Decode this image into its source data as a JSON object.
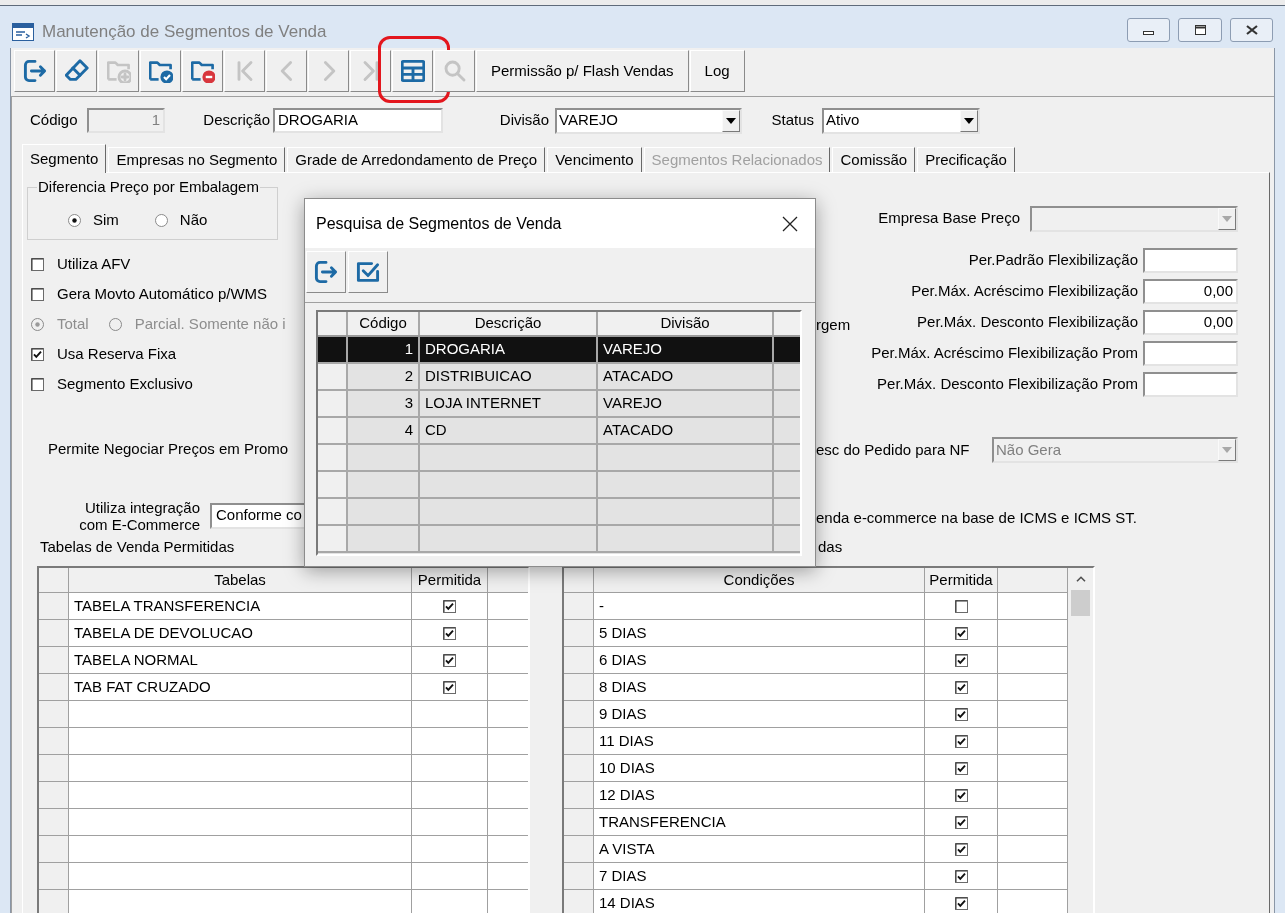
{
  "window": {
    "title": "Manutenção de Segmentos de Venda"
  },
  "toolbar": [
    {
      "kind": "exit",
      "disabled": false,
      "highlighted": false
    },
    {
      "kind": "clear",
      "disabled": false,
      "highlighted": false
    },
    {
      "kind": "new",
      "disabled": true,
      "highlighted": false
    },
    {
      "kind": "save",
      "disabled": false,
      "highlighted": false
    },
    {
      "kind": "delete",
      "disabled": false,
      "highlighted": false
    },
    {
      "kind": "first",
      "disabled": true,
      "highlighted": false
    },
    {
      "kind": "previous",
      "disabled": true,
      "highlighted": false
    },
    {
      "kind": "next",
      "disabled": true,
      "highlighted": false
    },
    {
      "kind": "last",
      "disabled": true,
      "highlighted": false
    },
    {
      "kind": "grid",
      "disabled": false,
      "highlighted": true
    },
    {
      "kind": "search",
      "disabled": true,
      "highlighted": false
    },
    {
      "kind": "text",
      "label": "Permissão p/ Flash Vendas",
      "disabled": false,
      "highlighted": false
    },
    {
      "kind": "text",
      "label": "Log",
      "disabled": false,
      "highlighted": false
    }
  ],
  "header_fields": [
    {
      "kind": "number",
      "label": "Código",
      "value": "1",
      "disabled": true
    },
    {
      "kind": "text",
      "label": "Descrição",
      "value": "DROGARIA",
      "disabled": false
    },
    {
      "kind": "select",
      "label": "Divisão",
      "value": "VAREJO",
      "disabled": false
    },
    {
      "kind": "select",
      "label": "Status",
      "value": "Ativo",
      "disabled": false
    }
  ],
  "tabs": [
    {
      "label": "Segmento",
      "selected": true,
      "disabled": false
    },
    {
      "label": "Empresas no Segmento",
      "selected": false,
      "disabled": false
    },
    {
      "label": "Grade de Arredondamento de Preço",
      "selected": false,
      "disabled": false
    },
    {
      "label": "Vencimento",
      "selected": false,
      "disabled": false
    },
    {
      "label": "Segmentos Relacionados",
      "selected": false,
      "disabled": true
    },
    {
      "label": "Comissão",
      "selected": false,
      "disabled": false
    },
    {
      "label": "Precificação",
      "selected": false,
      "disabled": false
    }
  ],
  "segment_tab": {
    "package_pricing": {
      "title": "Diferencia Preço por Embalagem",
      "options": [
        {
          "label": "Sim",
          "selected": true
        },
        {
          "label": "Não",
          "selected": false
        }
      ]
    },
    "left_options": [
      {
        "kind": "checkbox",
        "label": "Utiliza AFV",
        "checked": false
      },
      {
        "kind": "checkbox",
        "label": "Gera Movto Automático p/WMS",
        "checked": false
      },
      {
        "kind": "radio_group",
        "disabled": true,
        "options": [
          {
            "label": "Total",
            "selected": true
          },
          {
            "label": "Parcial. Somente não i",
            "selected": false
          }
        ]
      },
      {
        "kind": "checkbox",
        "label": "Usa Reserva Fixa",
        "checked": true
      },
      {
        "kind": "checkbox",
        "label": "Segmento Exclusivo",
        "checked": false
      }
    ],
    "promo_label": "Permite Negociar Preços em Promo",
    "ecommerce": {
      "label": "Utiliza integração com E-Commerce",
      "value": "Conforme co"
    },
    "company_base": {
      "label": "Empresa Base Preço",
      "disabled": true
    },
    "flex_fields": [
      {
        "label": "Per.Padrão Flexibilização"
      },
      {
        "label": "Per.Máx. Acréscimo Flexibilização",
        "value": "0,00"
      },
      {
        "label": "Per.Máx. Desconto Flexibilização",
        "value": "0,00"
      },
      {
        "label": "Per.Máx. Acréscimo Flexibilização Prom"
      },
      {
        "label": "Per.Máx. Desconto Flexibilização Prom"
      }
    ],
    "cut_text_1": "rgem",
    "nf_select": {
      "label": "esc do Pedido para NF",
      "value": "Não Gera",
      "disabled": true
    },
    "cut_text_2": "enda e-commerce na base de ICMS e ICMS ST.",
    "sales_tables": {
      "title": "Tabelas de Venda Permitidas",
      "columns": [
        "Tabelas",
        "Permitida"
      ],
      "rows": [
        {
          "name": "TABELA TRANSFERENCIA",
          "checked": true
        },
        {
          "name": "TABELA DE DEVOLUCAO",
          "checked": true
        },
        {
          "name": "TABELA NORMAL",
          "checked": true
        },
        {
          "name": "TAB FAT CRUZADO",
          "checked": true
        }
      ]
    },
    "conditions": {
      "title": "das",
      "columns": [
        "Condições",
        "Permitida"
      ],
      "rows": [
        {
          "name": "-",
          "checked": false
        },
        {
          "name": "5 DIAS",
          "checked": true
        },
        {
          "name": "6 DIAS",
          "checked": true
        },
        {
          "name": "8 DIAS",
          "checked": true
        },
        {
          "name": "9 DIAS",
          "checked": true
        },
        {
          "name": "11 DIAS",
          "checked": true
        },
        {
          "name": "10 DIAS",
          "checked": true
        },
        {
          "name": "12 DIAS",
          "checked": true
        },
        {
          "name": "TRANSFERENCIA",
          "checked": true
        },
        {
          "name": "A VISTA",
          "checked": true
        },
        {
          "name": "7 DIAS",
          "checked": true
        },
        {
          "name": "14 DIAS",
          "checked": true
        }
      ]
    }
  },
  "search_dialog": {
    "title": "Pesquisa de Segmentos de Venda",
    "toolbar": [
      {
        "kind": "exit"
      },
      {
        "kind": "confirm"
      }
    ],
    "columns": [
      "Código",
      "Descrição",
      "Divisão"
    ],
    "rows": [
      {
        "cells": [
          "1",
          "DROGARIA",
          "VAREJO"
        ],
        "selected": true
      },
      {
        "cells": [
          "2",
          "DISTRIBUICAO",
          "ATACADO"
        ],
        "selected": false
      },
      {
        "cells": [
          "3",
          "LOJA INTERNET",
          "VAREJO"
        ],
        "selected": false
      },
      {
        "cells": [
          "4",
          "CD",
          "ATACADO"
        ],
        "selected": false
      }
    ]
  }
}
